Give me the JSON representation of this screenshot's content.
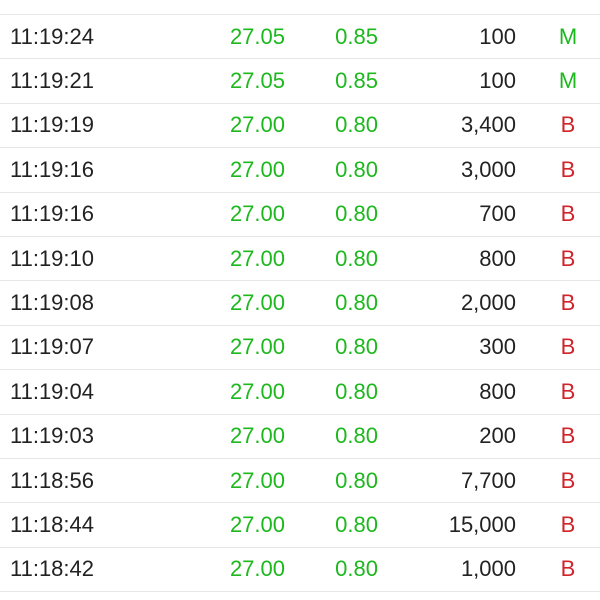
{
  "colors": {
    "up": "#1db81d",
    "text": "#222222",
    "buy": "#d0242b",
    "mid": "#1db81d",
    "divider": "#e6e6e6"
  },
  "trades": [
    {
      "time": "11:19:24",
      "price": "27.05",
      "change": "0.85",
      "volume": "100",
      "side": "M",
      "side_type": "mid"
    },
    {
      "time": "11:19:21",
      "price": "27.05",
      "change": "0.85",
      "volume": "100",
      "side": "M",
      "side_type": "mid"
    },
    {
      "time": "11:19:19",
      "price": "27.00",
      "change": "0.80",
      "volume": "3,400",
      "side": "B",
      "side_type": "buy"
    },
    {
      "time": "11:19:16",
      "price": "27.00",
      "change": "0.80",
      "volume": "3,000",
      "side": "B",
      "side_type": "buy"
    },
    {
      "time": "11:19:16",
      "price": "27.00",
      "change": "0.80",
      "volume": "700",
      "side": "B",
      "side_type": "buy"
    },
    {
      "time": "11:19:10",
      "price": "27.00",
      "change": "0.80",
      "volume": "800",
      "side": "B",
      "side_type": "buy"
    },
    {
      "time": "11:19:08",
      "price": "27.00",
      "change": "0.80",
      "volume": "2,000",
      "side": "B",
      "side_type": "buy"
    },
    {
      "time": "11:19:07",
      "price": "27.00",
      "change": "0.80",
      "volume": "300",
      "side": "B",
      "side_type": "buy"
    },
    {
      "time": "11:19:04",
      "price": "27.00",
      "change": "0.80",
      "volume": "800",
      "side": "B",
      "side_type": "buy"
    },
    {
      "time": "11:19:03",
      "price": "27.00",
      "change": "0.80",
      "volume": "200",
      "side": "B",
      "side_type": "buy"
    },
    {
      "time": "11:18:56",
      "price": "27.00",
      "change": "0.80",
      "volume": "7,700",
      "side": "B",
      "side_type": "buy"
    },
    {
      "time": "11:18:44",
      "price": "27.00",
      "change": "0.80",
      "volume": "15,000",
      "side": "B",
      "side_type": "buy"
    },
    {
      "time": "11:18:42",
      "price": "27.00",
      "change": "0.80",
      "volume": "1,000",
      "side": "B",
      "side_type": "buy"
    }
  ]
}
